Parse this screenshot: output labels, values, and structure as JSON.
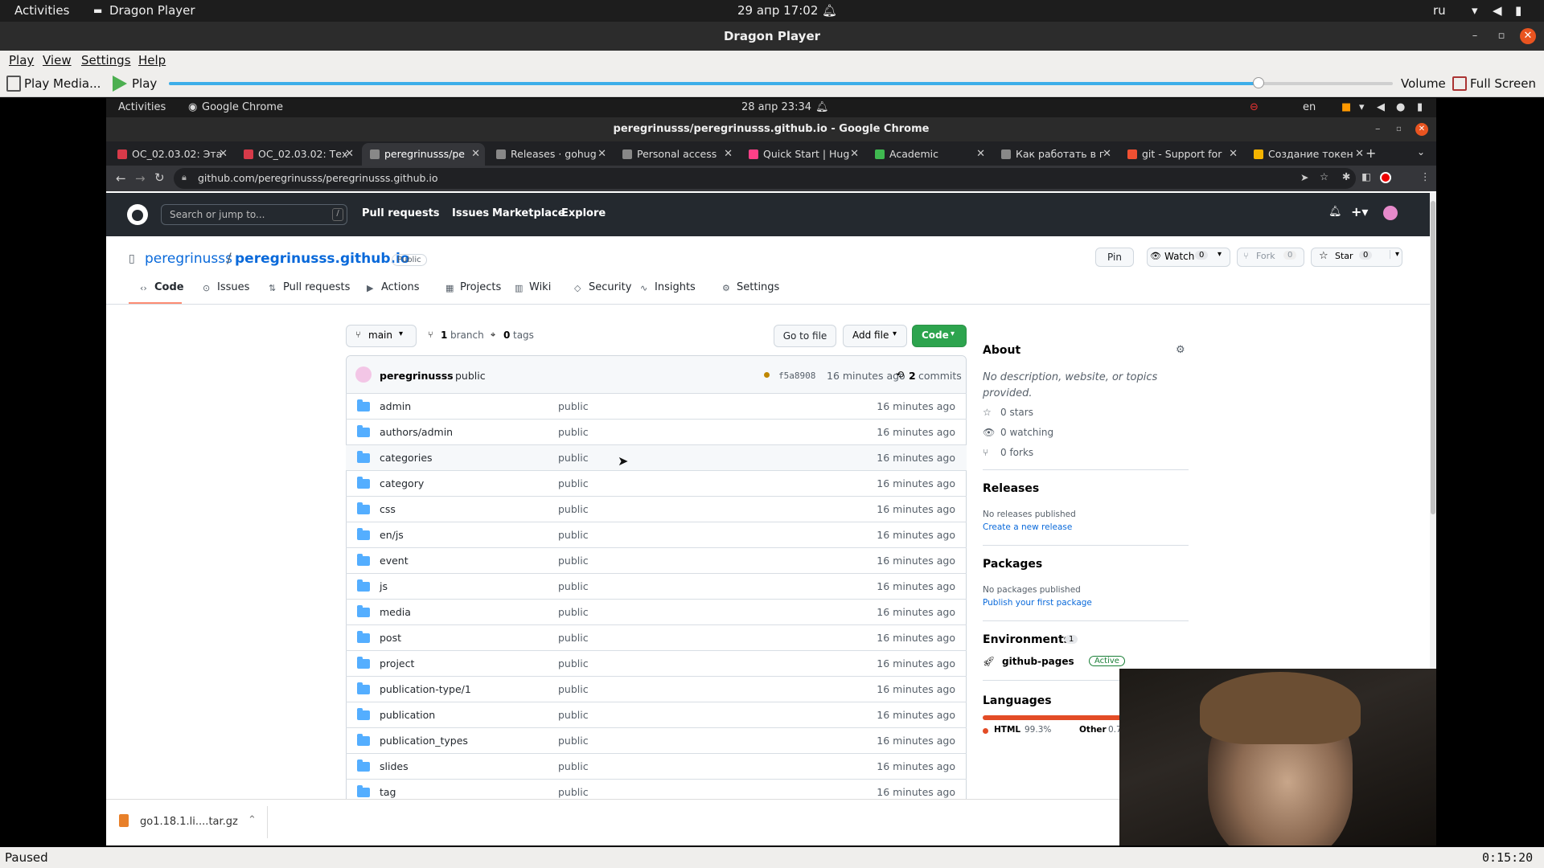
{
  "outer": {
    "activities": "Activities",
    "app": "Dragon Player",
    "datetime": "29 апр  17:02",
    "lang": "ru"
  },
  "dragon": {
    "title": "Dragon Player",
    "menu": [
      "Play",
      "View",
      "Settings",
      "Help"
    ],
    "toolbar": {
      "play_media": "Play Media...",
      "play": "Play",
      "volume": "Volume",
      "fullscreen": "Full Screen",
      "progress": 0.89
    },
    "status": "Paused",
    "time": "0:15:20"
  },
  "inner": {
    "activities": "Activities",
    "app": "Google Chrome",
    "datetime": "28 апр  23:34",
    "lang": "en",
    "window_title": "peregrinusss/peregrinusss.github.io - Google Chrome",
    "tabs": [
      {
        "label": "ОС_02.03.02: Эта",
        "color": "#d73a49"
      },
      {
        "label": "ОС_02.03.02: Тех",
        "color": "#d73a49"
      },
      {
        "label": "peregrinusss/pe",
        "color": "#888888"
      },
      {
        "label": "Releases · gohug",
        "color": "#888888"
      },
      {
        "label": "Personal access",
        "color": "#888888"
      },
      {
        "label": "Quick Start | Hug",
        "color": "#ff4088"
      },
      {
        "label": "Academic",
        "color": "#3fb950"
      },
      {
        "label": "Как работать в г",
        "color": "#888888"
      },
      {
        "label": "git - Support for",
        "color": "#f05032"
      },
      {
        "label": "Создание токен",
        "color": "#f4b400"
      }
    ],
    "url": "github.com/peregrinusss/peregrinusss.github.io"
  },
  "github": {
    "search_placeholder": "Search or jump to...",
    "slash": "/",
    "nav": [
      "Pull requests",
      "Issues",
      "Marketplace",
      "Explore"
    ],
    "owner": "peregrinusss",
    "sep": "/",
    "repo": "peregrinusss.github.io",
    "visibility": "Public",
    "pin": "Pin",
    "watch": "Watch",
    "watch_count": "0",
    "fork": "Fork",
    "fork_count": "0",
    "star": "Star",
    "star_count": "0",
    "tabs": [
      "Code",
      "Issues",
      "Pull requests",
      "Actions",
      "Projects",
      "Wiki",
      "Security",
      "Insights",
      "Settings"
    ],
    "branch": "main",
    "branches": "1",
    "branches_label": "branch",
    "tags": "0",
    "tags_label": "tags",
    "go_to_file": "Go to file",
    "add_file": "Add file",
    "code": "Code",
    "commit": {
      "author": "peregrinusss",
      "message": "public",
      "sha": "f5a8908",
      "time": "16 minutes ago",
      "commits": "2",
      "commits_label": "commits"
    },
    "files": [
      {
        "name": "admin",
        "msg": "public",
        "age": "16 minutes ago"
      },
      {
        "name": "authors/admin",
        "msg": "public",
        "age": "16 minutes ago"
      },
      {
        "name": "categories",
        "msg": "public",
        "age": "16 minutes ago"
      },
      {
        "name": "category",
        "msg": "public",
        "age": "16 minutes ago"
      },
      {
        "name": "css",
        "msg": "public",
        "age": "16 minutes ago"
      },
      {
        "name": "en/js",
        "msg": "public",
        "age": "16 minutes ago"
      },
      {
        "name": "event",
        "msg": "public",
        "age": "16 minutes ago"
      },
      {
        "name": "js",
        "msg": "public",
        "age": "16 minutes ago"
      },
      {
        "name": "media",
        "msg": "public",
        "age": "16 minutes ago"
      },
      {
        "name": "post",
        "msg": "public",
        "age": "16 minutes ago"
      },
      {
        "name": "project",
        "msg": "public",
        "age": "16 minutes ago"
      },
      {
        "name": "publication-type/1",
        "msg": "public",
        "age": "16 minutes ago"
      },
      {
        "name": "publication",
        "msg": "public",
        "age": "16 minutes ago"
      },
      {
        "name": "publication_types",
        "msg": "public",
        "age": "16 minutes ago"
      },
      {
        "name": "slides",
        "msg": "public",
        "age": "16 minutes ago"
      },
      {
        "name": "tag",
        "msg": "public",
        "age": "16 minutes ago"
      }
    ],
    "about": {
      "title": "About",
      "desc": "No description, website, or topics provided.",
      "stars": "0 stars",
      "watching": "0 watching",
      "forks": "0 forks"
    },
    "releases": {
      "title": "Releases",
      "none": "No releases published",
      "link": "Create a new release"
    },
    "packages": {
      "title": "Packages",
      "none": "No packages published",
      "link": "Publish your first package"
    },
    "environments": {
      "title": "Environments",
      "count": "1",
      "name": "github-pages",
      "badge": "Active"
    },
    "languages": {
      "title": "Languages",
      "html": "HTML",
      "html_pct": "99.3%",
      "other": "Other",
      "other_pct": "0.7"
    }
  },
  "download": {
    "file": "go1.18.1.li....tar.gz"
  }
}
